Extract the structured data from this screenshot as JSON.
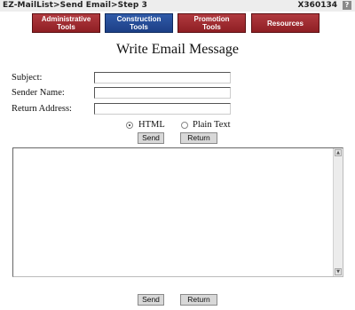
{
  "header": {
    "breadcrumb": "EZ-MailList>Send Email>Step 3",
    "user_id": "X360134",
    "help_label": "?"
  },
  "nav": {
    "tabs": [
      {
        "line1": "Administrative",
        "line2": "Tools"
      },
      {
        "line1": "Construction",
        "line2": "Tools"
      },
      {
        "line1": "Promotion",
        "line2": "Tools"
      },
      {
        "line1": "Resources",
        "line2": ""
      }
    ],
    "active_index": 1
  },
  "page": {
    "title": "Write Email Message"
  },
  "form": {
    "subject_label": "Subject:",
    "subject_value": "",
    "sender_label": "Sender Name:",
    "sender_value": "",
    "return_label": "Return Address:",
    "return_value": "",
    "format_options": [
      {
        "label": "HTML",
        "selected": true
      },
      {
        "label": "Plain Text",
        "selected": false
      }
    ]
  },
  "buttons": {
    "send": "Send",
    "return": "Return"
  },
  "message": {
    "value": ""
  },
  "colors": {
    "tab_red": "#9e2a2f",
    "tab_blue": "#234a96"
  }
}
